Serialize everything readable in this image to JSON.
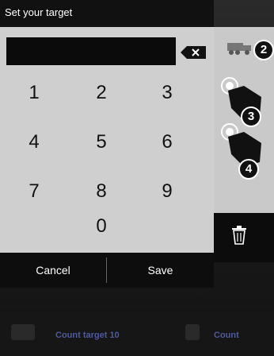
{
  "dialog": {
    "title": "Set your target",
    "input_value": "",
    "keys": [
      "1",
      "2",
      "3",
      "4",
      "5",
      "6",
      "7",
      "8",
      "9",
      "0"
    ],
    "cancel_label": "Cancel",
    "save_label": "Save"
  },
  "side": {
    "badges": [
      "2",
      "3",
      "4"
    ]
  },
  "bottom": {
    "left_label": "Count target 10",
    "right_label": "Count"
  },
  "colors": {
    "dialog_bg": "#cfcfcf",
    "bar_bg": "#0d0d0d",
    "accent_text": "#4d5a9e"
  }
}
